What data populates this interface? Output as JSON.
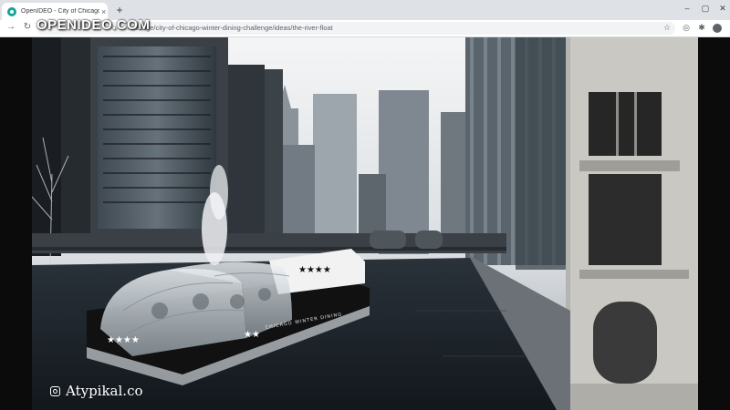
{
  "tab": {
    "title": "OpenIDEO - City of Chicago Wi",
    "close_glyph": "×",
    "favicon": "openideo-favicon-icon"
  },
  "new_tab_glyph": "+",
  "window_controls": {
    "minimize": "–",
    "maximize": "▢",
    "close": "✕"
  },
  "toolbar": {
    "back_glyph": "→",
    "reload_glyph": "↻",
    "url": "hallenge/city-of-chicago-winter-dining-challenge/ideas/the-river-float",
    "bookmark_glyph": "☆",
    "extensions": [
      "◎",
      "✱"
    ]
  },
  "watermark": "OPENIDEO.COM",
  "image": {
    "credit": "Atypikal.co",
    "barge_sign": "CHICAGO WINTER DINING",
    "accent_colors": {
      "sky": "#e9ecef",
      "water": "#1c2229",
      "barge": "#111111",
      "stars": "#ffffff"
    }
  }
}
